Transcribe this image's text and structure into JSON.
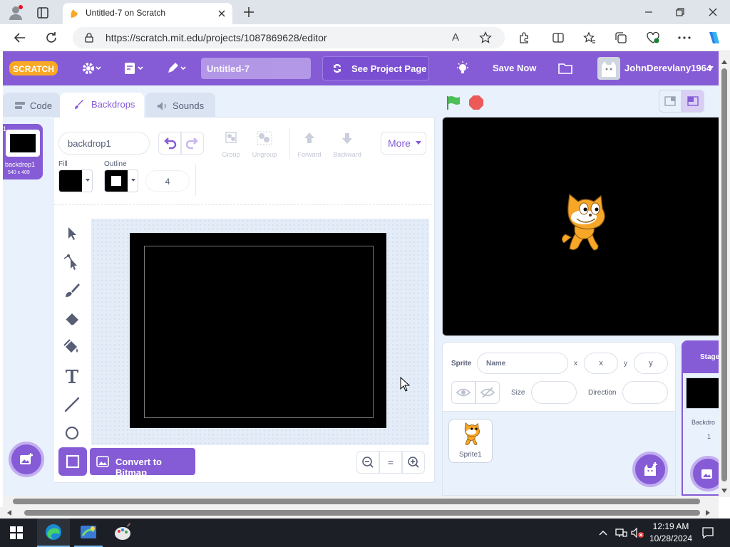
{
  "browser": {
    "tab_title": "Untitled-7 on Scratch",
    "url": "https://scratch.mit.edu/projects/1087869628/editor",
    "read_aloud_label": "A"
  },
  "menubar": {
    "logo": "SCRATCH",
    "project_title": "Untitled-7",
    "see_project_page": "See Project Page",
    "save_now": "Save Now",
    "username": "JohnDerevlany1964"
  },
  "editor_tabs": {
    "code": "Code",
    "backdrops": "Backdrops",
    "sounds": "Sounds"
  },
  "costume_list": {
    "items": [
      {
        "index": "1",
        "name": "backdrop1",
        "size": "540 x 409"
      }
    ]
  },
  "paint_editor": {
    "costume_name": "backdrop1",
    "group": "Group",
    "ungroup": "Ungroup",
    "forward": "Forward",
    "backward": "Backward",
    "more": "More",
    "fill_label": "Fill",
    "outline_label": "Outline",
    "outline_width": "4",
    "convert_button": "Convert to Bitmap",
    "zoom_equal": "="
  },
  "sprite_info": {
    "sprite_label": "Sprite",
    "name_placeholder": "Name",
    "x_label": "x",
    "x_placeholder": "x",
    "y_label": "y",
    "y_placeholder": "y",
    "size_label": "Size",
    "direction_label": "Direction"
  },
  "sprites": [
    {
      "name": "Sprite1"
    }
  ],
  "stage_panel": {
    "title": "Stage",
    "backdrops_label": "Backdro",
    "backdrops_count": "1"
  },
  "taskbar": {
    "time": "12:19 AM",
    "date": "10/28/2024"
  },
  "colors": {
    "scratch_purple": "#855cd6",
    "scratch_purple_dark": "#774dcb",
    "editor_bg": "#e9f1fc",
    "stage_bg": "#000000",
    "green_flag": "#4cbf56",
    "stop": "#ec5959"
  }
}
